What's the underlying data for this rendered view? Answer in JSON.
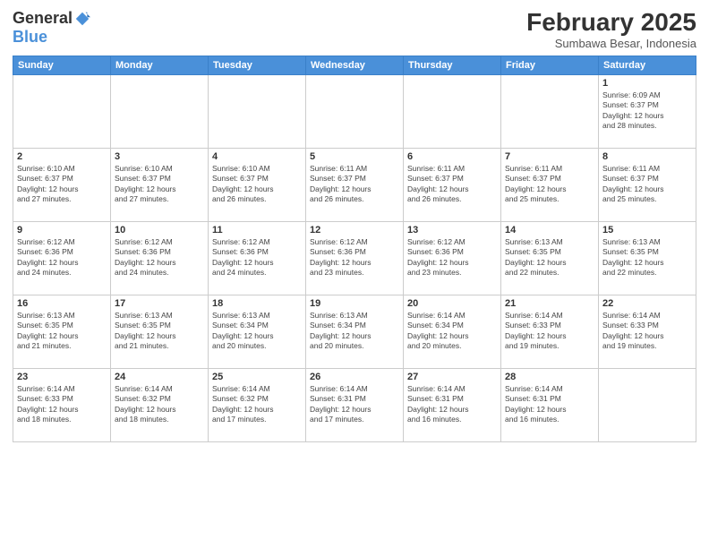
{
  "logo": {
    "general": "General",
    "blue": "Blue"
  },
  "title": "February 2025",
  "subtitle": "Sumbawa Besar, Indonesia",
  "days": [
    "Sunday",
    "Monday",
    "Tuesday",
    "Wednesday",
    "Thursday",
    "Friday",
    "Saturday"
  ],
  "weeks": [
    [
      {
        "day": "",
        "info": ""
      },
      {
        "day": "",
        "info": ""
      },
      {
        "day": "",
        "info": ""
      },
      {
        "day": "",
        "info": ""
      },
      {
        "day": "",
        "info": ""
      },
      {
        "day": "",
        "info": ""
      },
      {
        "day": "1",
        "info": "Sunrise: 6:09 AM\nSunset: 6:37 PM\nDaylight: 12 hours\nand 28 minutes."
      }
    ],
    [
      {
        "day": "2",
        "info": "Sunrise: 6:10 AM\nSunset: 6:37 PM\nDaylight: 12 hours\nand 27 minutes."
      },
      {
        "day": "3",
        "info": "Sunrise: 6:10 AM\nSunset: 6:37 PM\nDaylight: 12 hours\nand 27 minutes."
      },
      {
        "day": "4",
        "info": "Sunrise: 6:10 AM\nSunset: 6:37 PM\nDaylight: 12 hours\nand 26 minutes."
      },
      {
        "day": "5",
        "info": "Sunrise: 6:11 AM\nSunset: 6:37 PM\nDaylight: 12 hours\nand 26 minutes."
      },
      {
        "day": "6",
        "info": "Sunrise: 6:11 AM\nSunset: 6:37 PM\nDaylight: 12 hours\nand 26 minutes."
      },
      {
        "day": "7",
        "info": "Sunrise: 6:11 AM\nSunset: 6:37 PM\nDaylight: 12 hours\nand 25 minutes."
      },
      {
        "day": "8",
        "info": "Sunrise: 6:11 AM\nSunset: 6:37 PM\nDaylight: 12 hours\nand 25 minutes."
      }
    ],
    [
      {
        "day": "9",
        "info": "Sunrise: 6:12 AM\nSunset: 6:36 PM\nDaylight: 12 hours\nand 24 minutes."
      },
      {
        "day": "10",
        "info": "Sunrise: 6:12 AM\nSunset: 6:36 PM\nDaylight: 12 hours\nand 24 minutes."
      },
      {
        "day": "11",
        "info": "Sunrise: 6:12 AM\nSunset: 6:36 PM\nDaylight: 12 hours\nand 24 minutes."
      },
      {
        "day": "12",
        "info": "Sunrise: 6:12 AM\nSunset: 6:36 PM\nDaylight: 12 hours\nand 23 minutes."
      },
      {
        "day": "13",
        "info": "Sunrise: 6:12 AM\nSunset: 6:36 PM\nDaylight: 12 hours\nand 23 minutes."
      },
      {
        "day": "14",
        "info": "Sunrise: 6:13 AM\nSunset: 6:35 PM\nDaylight: 12 hours\nand 22 minutes."
      },
      {
        "day": "15",
        "info": "Sunrise: 6:13 AM\nSunset: 6:35 PM\nDaylight: 12 hours\nand 22 minutes."
      }
    ],
    [
      {
        "day": "16",
        "info": "Sunrise: 6:13 AM\nSunset: 6:35 PM\nDaylight: 12 hours\nand 21 minutes."
      },
      {
        "day": "17",
        "info": "Sunrise: 6:13 AM\nSunset: 6:35 PM\nDaylight: 12 hours\nand 21 minutes."
      },
      {
        "day": "18",
        "info": "Sunrise: 6:13 AM\nSunset: 6:34 PM\nDaylight: 12 hours\nand 20 minutes."
      },
      {
        "day": "19",
        "info": "Sunrise: 6:13 AM\nSunset: 6:34 PM\nDaylight: 12 hours\nand 20 minutes."
      },
      {
        "day": "20",
        "info": "Sunrise: 6:14 AM\nSunset: 6:34 PM\nDaylight: 12 hours\nand 20 minutes."
      },
      {
        "day": "21",
        "info": "Sunrise: 6:14 AM\nSunset: 6:33 PM\nDaylight: 12 hours\nand 19 minutes."
      },
      {
        "day": "22",
        "info": "Sunrise: 6:14 AM\nSunset: 6:33 PM\nDaylight: 12 hours\nand 19 minutes."
      }
    ],
    [
      {
        "day": "23",
        "info": "Sunrise: 6:14 AM\nSunset: 6:33 PM\nDaylight: 12 hours\nand 18 minutes."
      },
      {
        "day": "24",
        "info": "Sunrise: 6:14 AM\nSunset: 6:32 PM\nDaylight: 12 hours\nand 18 minutes."
      },
      {
        "day": "25",
        "info": "Sunrise: 6:14 AM\nSunset: 6:32 PM\nDaylight: 12 hours\nand 17 minutes."
      },
      {
        "day": "26",
        "info": "Sunrise: 6:14 AM\nSunset: 6:31 PM\nDaylight: 12 hours\nand 17 minutes."
      },
      {
        "day": "27",
        "info": "Sunrise: 6:14 AM\nSunset: 6:31 PM\nDaylight: 12 hours\nand 16 minutes."
      },
      {
        "day": "28",
        "info": "Sunrise: 6:14 AM\nSunset: 6:31 PM\nDaylight: 12 hours\nand 16 minutes."
      },
      {
        "day": "",
        "info": ""
      }
    ]
  ]
}
